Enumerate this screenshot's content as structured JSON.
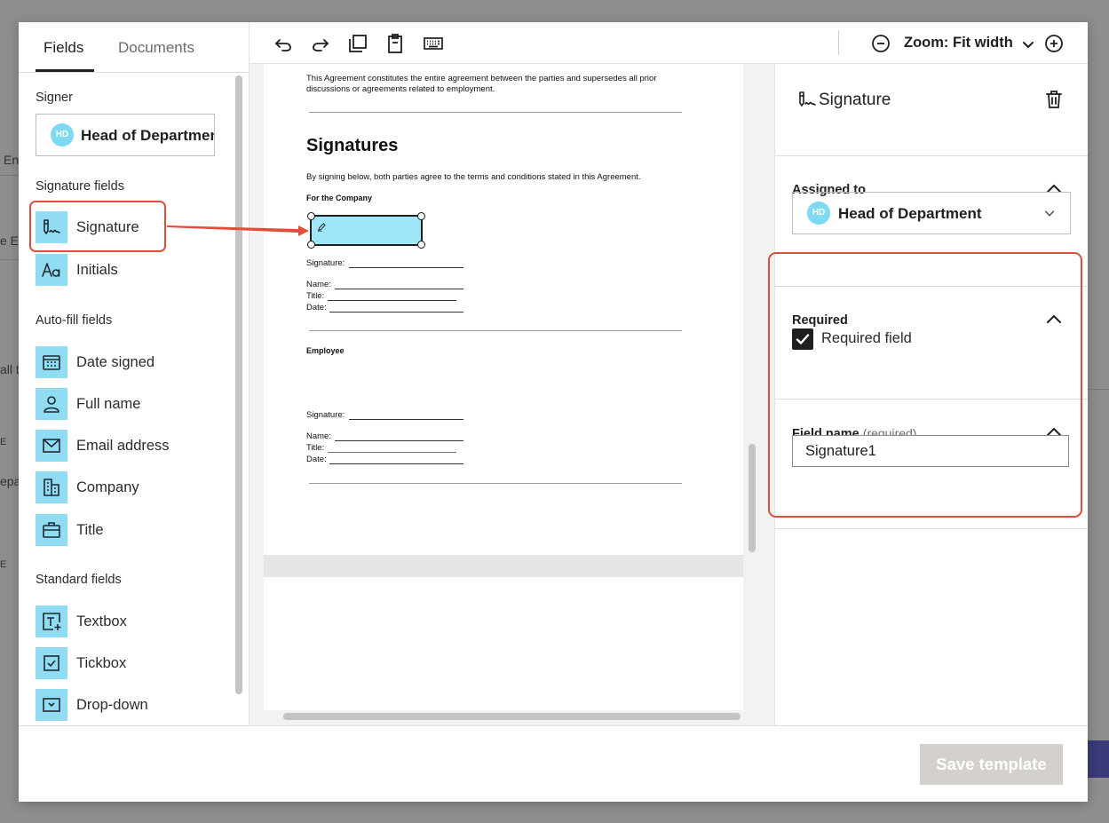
{
  "background": {
    "fragments": [
      "En",
      "e E",
      "all t",
      "E",
      "epa",
      "E"
    ]
  },
  "left_panel": {
    "tabs": [
      {
        "label": "Fields",
        "active": true
      },
      {
        "label": "Documents",
        "active": false
      }
    ],
    "signer_section": "Signer",
    "signer": {
      "initials": "HD",
      "name": "Head of Department"
    },
    "signature_section": "Signature fields",
    "signature_fields": [
      {
        "label": "Signature",
        "icon": "signature-icon"
      },
      {
        "label": "Initials",
        "icon": "initials-icon"
      }
    ],
    "autofill_section": "Auto-fill fields",
    "autofill_fields": [
      {
        "label": "Date signed",
        "icon": "calendar-icon"
      },
      {
        "label": "Full name",
        "icon": "person-icon"
      },
      {
        "label": "Email address",
        "icon": "envelope-icon"
      },
      {
        "label": "Company",
        "icon": "building-icon"
      },
      {
        "label": "Title",
        "icon": "briefcase-icon"
      }
    ],
    "standard_section": "Standard fields",
    "standard_fields": [
      {
        "label": "Textbox",
        "icon": "textbox-icon"
      },
      {
        "label": "Tickbox",
        "icon": "tickbox-icon"
      },
      {
        "label": "Drop-down",
        "icon": "dropdown-icon"
      }
    ]
  },
  "toolbar": {
    "zoom_label": "Zoom: Fit width"
  },
  "document": {
    "intro": "This Agreement constitutes the entire agreement between the parties and supersedes all prior",
    "intro2": "discussions or agreements related to employment.",
    "heading": "Signatures",
    "lead": "By signing below, both parties agree to the terms and conditions stated in this Agreement.",
    "company_label": "For the Company",
    "employee_label": "Employee",
    "signature_line": "Signature:",
    "name_line": "Name:",
    "title_line": "Title:",
    "date_line": "Date:"
  },
  "right_panel": {
    "title": "Signature",
    "assigned_label": "Assigned to",
    "assignee": {
      "initials": "HD",
      "name": "Head of Department"
    },
    "required_label": "Required",
    "required_checkbox": "Required field",
    "required_checked": true,
    "field_name_label": "Field name",
    "field_name_hint": "(required)",
    "field_name_value": "Signature1"
  },
  "footer": {
    "save_label": "Save template"
  },
  "colors": {
    "accent_highlight": "#e04e3a",
    "field_icon_bg": "#8fdcf3",
    "avatar": "#7fd9f2",
    "save_disabled": "#d4d0cb"
  }
}
